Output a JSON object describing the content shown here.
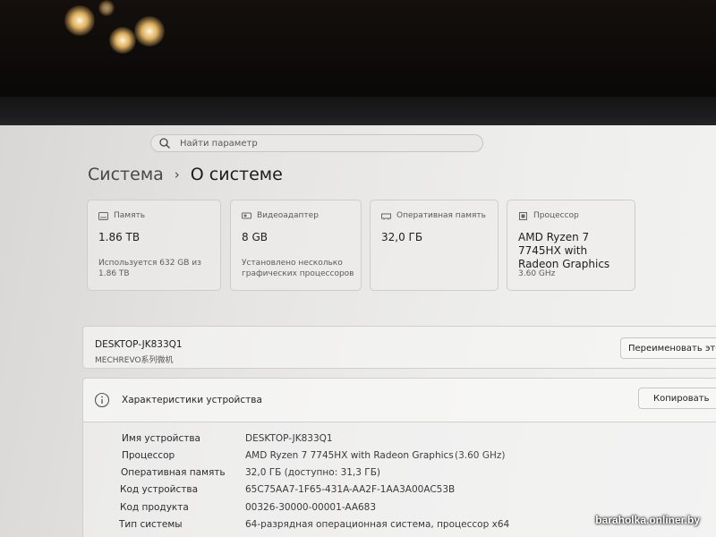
{
  "search": {
    "placeholder": "Найти параметр"
  },
  "breadcrumb": {
    "parent": "Система",
    "separator": "›",
    "current": "О системе"
  },
  "cards": [
    {
      "title": "Память",
      "value": "1.86 TB",
      "note": "Используется 632 GB из 1.86 TB",
      "icon": "storage-icon"
    },
    {
      "title": "Видеоадаптер",
      "value": "8 GB",
      "note": "Установлено несколько графических процессоров",
      "icon": "gpu-icon"
    },
    {
      "title": "Оперативная память",
      "value": "32,0 ГБ",
      "note": "",
      "icon": "ram-icon"
    },
    {
      "title": "Процессор",
      "value": "AMD Ryzen 7 7745HX with Radeon Graphics",
      "note": "3.60 GHz",
      "icon": "cpu-icon"
    }
  ],
  "device": {
    "name": "DESKTOP-JK833Q1",
    "model": "MECHREVO系列微机",
    "rename_label": "Переименовать этот ПК"
  },
  "specs": {
    "title": "Характеристики устройства",
    "copy_label": "Копировать",
    "rows": [
      {
        "label": "Имя устройства",
        "value": "DESKTOP-JK833Q1",
        "extra": ""
      },
      {
        "label": "Процессор",
        "value": "AMD Ryzen 7 7745HX with Radeon Graphics",
        "extra": "(3.60 GHz)"
      },
      {
        "label": "Оперативная память",
        "value": "32,0 ГБ (доступно: 31,3 ГБ)",
        "extra": ""
      },
      {
        "label": "Код устройства",
        "value": "65C75AA7-1F65-431A-AA2F-1AA3A00AC53B",
        "extra": ""
      },
      {
        "label": "Код продукта",
        "value": "00326-30000-00001-AA683",
        "extra": ""
      },
      {
        "label": "Тип системы",
        "value": "64-разрядная операционная система, процессор x64",
        "extra": ""
      }
    ]
  },
  "watermark": "baraholka.onliner.by"
}
